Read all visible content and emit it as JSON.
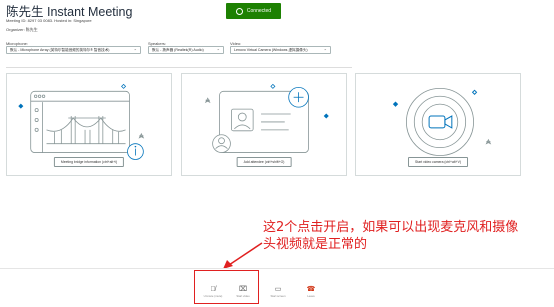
{
  "header": {
    "title": "陈先生 Instant Meeting",
    "status": "Connected",
    "meeting_id": "Meeting ID: 8297 03 0083. Hosted in: Singapore",
    "organizer": "Organizer: 陈先生"
  },
  "devices": {
    "microphone_label": "Microphone:",
    "microphone_value": "默认 - Microphone Array (英特尔智能音频的英特尔® 智音技术)",
    "speakers_label": "Speakers:",
    "speakers_value": "默认 - 扬声器 (Realtek(R) Audio)",
    "video_label": "Video:",
    "video_value": "Lenovo Virtual Camera (Windows 虚拟摄像头)"
  },
  "cards": [
    {
      "button": "Meeting bridge information (ctrl+alt+i)"
    },
    {
      "button": "Add attendee (ctrl+shift+O)"
    },
    {
      "button": "Start video camera (ctrl+alt+V)"
    }
  ],
  "annotation": {
    "line1": "这2个点击开启，如果可以出现麦克风和摄像",
    "line2": "头视频就是正常的"
  },
  "toolbar": [
    {
      "label": "Unmute (mute)",
      "icon": "muted-microphone-icon"
    },
    {
      "label": "Start video",
      "icon": "video-off-icon"
    },
    {
      "label": "Start screen",
      "icon": "screen-share-icon"
    },
    {
      "label": "Leave",
      "icon": "phone-hangup-icon"
    }
  ],
  "colors": {
    "accent": "#1d8102",
    "annotation": "#e02020",
    "illustration": "#0073bb"
  }
}
